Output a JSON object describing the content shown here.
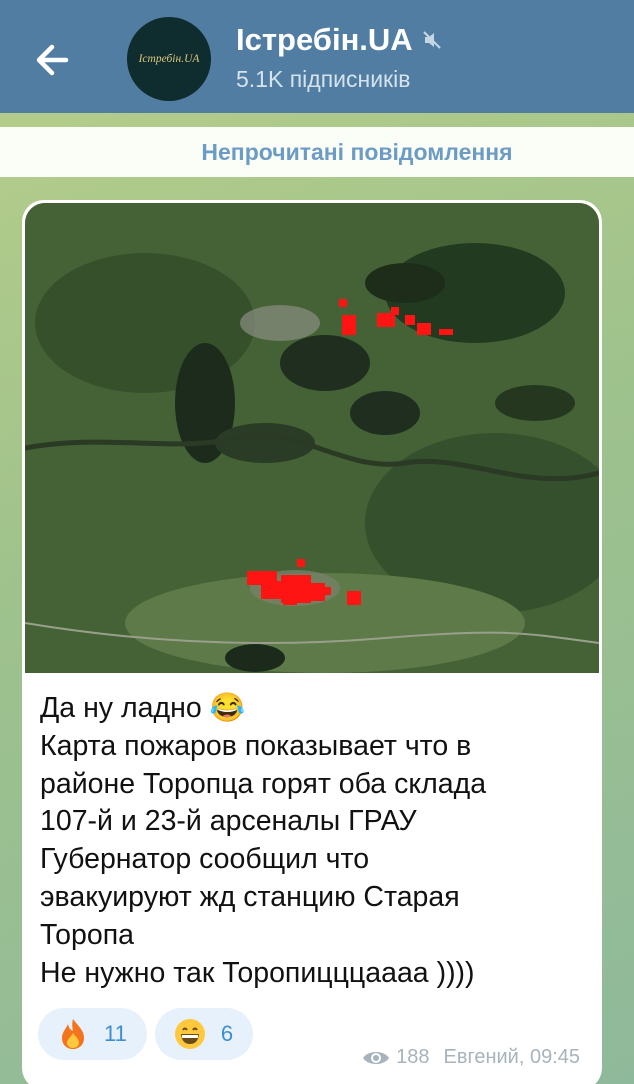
{
  "channel": {
    "name": "Істребін.UA",
    "subscribers": "5.1K підписників",
    "avatar_text": "Істребін.UA"
  },
  "banner": {
    "unread": "Непрочитані повідомлення"
  },
  "message": {
    "lines": [
      "Да ну ладно 😂",
      "Карта пожаров показывает что в",
      "районе Торопца горят оба склада",
      "107-й и 23-й арсеналы ГРАУ",
      "Губернатор сообщил что",
      "эвакуируют жд станцию Старая",
      "Торопа",
      "Не нужно так Торопицццаааа ))))"
    ],
    "reactions": [
      {
        "emoji": "fire-icon",
        "count": "11"
      },
      {
        "emoji": "grinning-face-icon",
        "count": "6"
      }
    ],
    "views": "188",
    "author_time": "Евгений, 09:45"
  },
  "colors": {
    "header": "#517da2",
    "reaction_bg": "#e7f1fb",
    "reaction_text": "#3e8ed0",
    "banner_text": "#6c9cc3"
  }
}
